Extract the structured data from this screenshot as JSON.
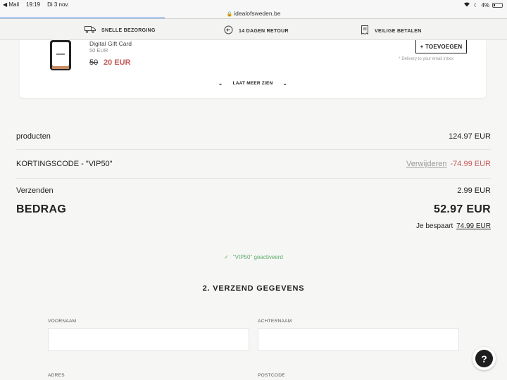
{
  "statusbar": {
    "back_app": "◀ Mail",
    "time": "19:19",
    "date": "Di 3 nov.",
    "battery": "4%"
  },
  "browser": {
    "url": "idealofsweden.be",
    "load_progress": 0.325
  },
  "benefits": [
    {
      "label": "SNELLE BEZORGING",
      "icon": "truck-icon"
    },
    {
      "label": "14 DAGEN RETOUR",
      "icon": "return-icon"
    },
    {
      "label": "VEILIGE BETALEN",
      "icon": "receipt-icon"
    }
  ],
  "product": {
    "name": "Digital Gift Card",
    "value": "50 EUR",
    "old_price": "50",
    "new_price": "20 EUR",
    "add_label": "+ TOEVOEGEN",
    "delivery_note": "Delivery to your email inbox"
  },
  "show_more": {
    "label": "LAAT MEER ZIEN"
  },
  "summary": {
    "products_label": "producten",
    "products_value": "124.97 EUR",
    "discount_label": "KORTINGSCODE - \"VIP50\"",
    "remove_label": "Verwijderen",
    "discount_value": "-74.99 EUR",
    "shipping_label": "Verzenden",
    "shipping_value": "2.99 EUR",
    "total_label": "BEDRAG",
    "total_value": "52.97 EUR",
    "saving_label": "Je bespaart",
    "saving_value": "74.99 EUR"
  },
  "coupon_status": "\"VIP50\" geactiveerd",
  "shipping_section": {
    "title": "2. VERZEND GEGEVENS",
    "fields": {
      "first_name": {
        "label": "VOORNAAM",
        "value": ""
      },
      "last_name": {
        "label": "ACHTERNAAM",
        "value": ""
      },
      "address": {
        "label": "ADRES"
      },
      "postcode": {
        "label": "POSTCODE"
      }
    }
  },
  "chat": {
    "icon": "question-icon",
    "glyph": "?"
  },
  "colors": {
    "accent": "#2f7bf5",
    "discount": "#c75b5b",
    "success": "#5fae6a"
  }
}
